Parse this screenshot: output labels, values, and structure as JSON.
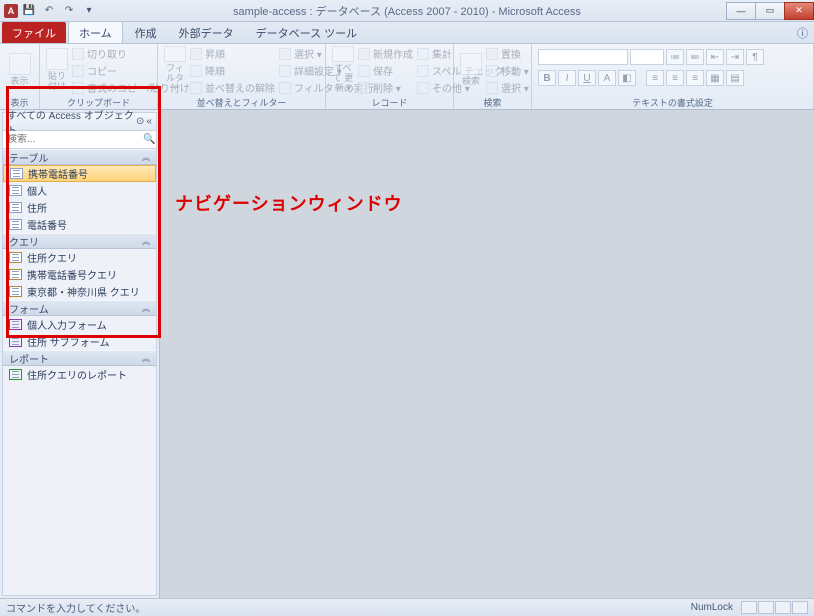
{
  "title": "sample-access : データベース (Access 2007 - 2010) - Microsoft Access",
  "tabs": {
    "file": "ファイル",
    "home": "ホーム",
    "create": "作成",
    "external": "外部データ",
    "dbtools": "データベース ツール"
  },
  "ribbon": {
    "view": {
      "label": "表示",
      "btn": "表示"
    },
    "clipboard": {
      "label": "クリップボード",
      "paste": "貼り付け",
      "cut": "切り取り",
      "copy": "コピー",
      "fmt": "書式のコピー/貼り付け"
    },
    "sortfilter": {
      "label": "並べ替えとフィルター",
      "filter": "フィルター",
      "asc": "昇順",
      "desc": "降順",
      "clear": "並べ替えの解除",
      "sel": "選択 ▾",
      "adv": "詳細設定 ▾",
      "toggle": "フィルターの実行"
    },
    "records": {
      "label": "レコード",
      "refresh": "すべて\n更新 ▾",
      "new": "新規作成",
      "save": "保存",
      "delete": "削除 ▾",
      "totals": "集計",
      "spell": "スペル チェック",
      "more": "その他 ▾"
    },
    "find": {
      "label": "検索",
      "find": "検索",
      "replace": "置換",
      "goto": "移動 ▾",
      "select": "選択 ▾"
    },
    "textfmt": {
      "label": "テキストの書式設定"
    }
  },
  "nav": {
    "header": "すべての Access オブジェクト",
    "search_ph": "検索...",
    "cats": {
      "tables": "テーブル",
      "queries": "クエリ",
      "forms": "フォーム",
      "reports": "レポート"
    },
    "tables": [
      "携帯電話番号",
      "個人",
      "住所",
      "電話番号"
    ],
    "queries": [
      "住所クエリ",
      "携帯電話番号クエリ",
      "東京都・神奈川県 クエリ"
    ],
    "forms": [
      "個人入力フォーム",
      "住所 サブフォーム"
    ],
    "reports": [
      "住所クエリのレポート"
    ]
  },
  "annotation": "ナビゲーションウィンドウ",
  "status": {
    "left": "コマンドを入力してください。",
    "numlock": "NumLock"
  }
}
